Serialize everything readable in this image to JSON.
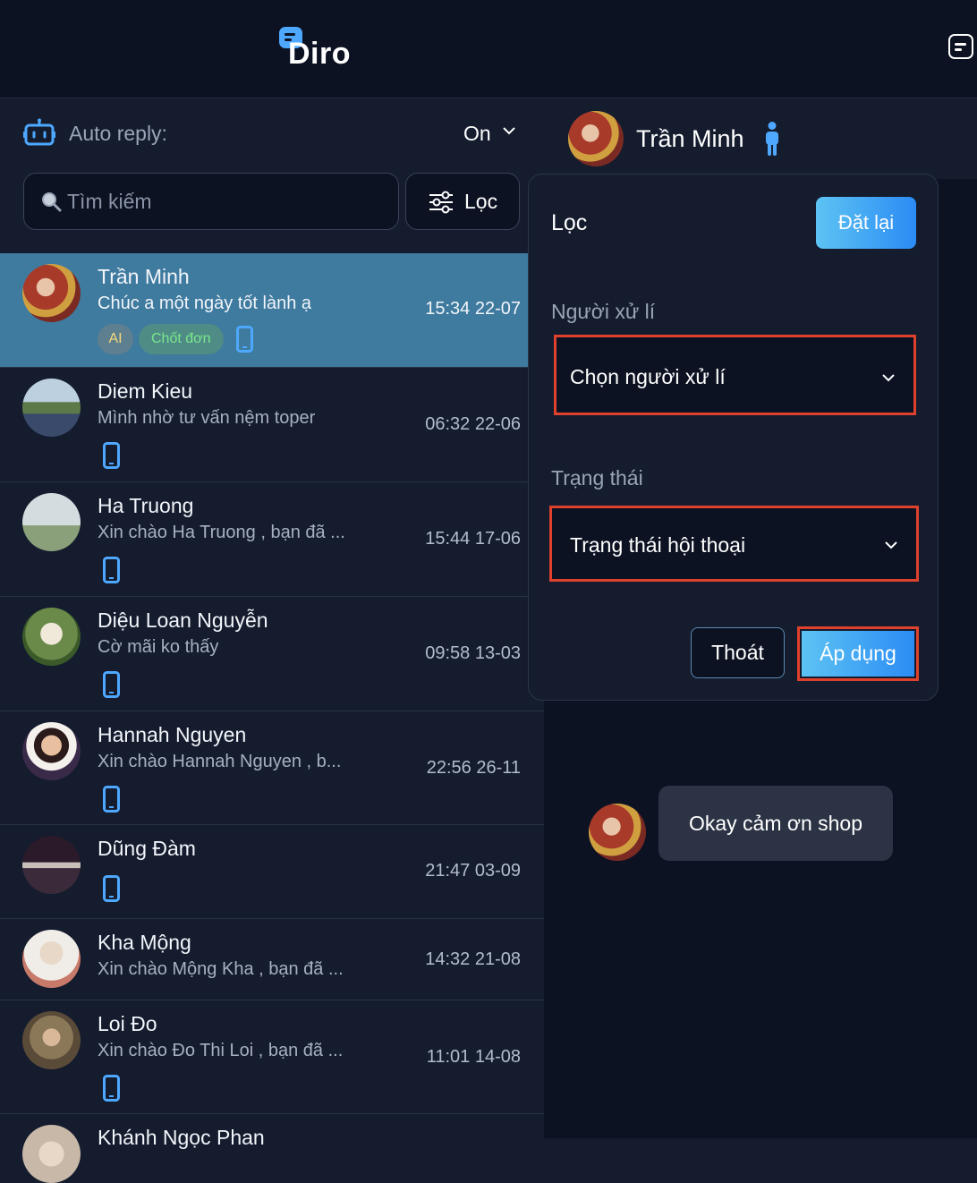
{
  "app": {
    "logo_text": "Diro"
  },
  "autoreply": {
    "label": "Auto reply:",
    "value": "On"
  },
  "search": {
    "placeholder": "Tìm kiếm",
    "value": ""
  },
  "filter_button": {
    "label": "Lọc"
  },
  "conversations": [
    {
      "name": "Trần Minh",
      "message": "Chúc a một ngày tốt lành ạ",
      "time": "15:34 22-07",
      "tags": [
        "AI",
        "Chốt đơn"
      ],
      "avatar_color": "#8a3a2e",
      "active": true
    },
    {
      "name": "Diem Kieu",
      "message": "Mình nhờ tư vấn nệm toper",
      "time": "06:32 22-06",
      "avatar_color": "#6a8fa8"
    },
    {
      "name": "Ha Truong",
      "message": "Xin chào Ha Truong , bạn đã ...",
      "time": "15:44 17-06",
      "avatar_color": "#8ea0a8"
    },
    {
      "name": "Diệu Loan Nguyễn",
      "message": "Cờ mãi ko thấy",
      "time": "09:58 13-03",
      "avatar_color": "#5e7a4a"
    },
    {
      "name": "Hannah Nguyen",
      "message": "Xin chào Hannah Nguyen , b...",
      "time": "22:56 26-11",
      "avatar_color": "#e8e4e0"
    },
    {
      "name": "Dũng Đàm",
      "message": "",
      "time": "21:47 03-09",
      "avatar_color": "#3a2e3a"
    },
    {
      "name": "Kha Mộng",
      "message": "Xin chào Mộng Kha , bạn đã ...",
      "time": "14:32 21-08",
      "avatar_color": "#d8d0c8"
    },
    {
      "name": "Loi Đo",
      "message": "Xin chào Đo Thi Loi , bạn đã ...",
      "time": "11:01 14-08",
      "avatar_color": "#8a7858"
    },
    {
      "name": "Khánh Ngọc Phan",
      "message": "",
      "time": "",
      "avatar_color": "#c8b8a8"
    }
  ],
  "chat": {
    "contact_name": "Trần Minh",
    "messages": [
      {
        "text": "Okay cảm ơn shop"
      }
    ]
  },
  "filter_panel": {
    "title": "Lọc",
    "reset_label": "Đặt lại",
    "handler_label": "Người xử lí",
    "handler_placeholder": "Chọn người xử lí",
    "status_label": "Trạng thái",
    "status_placeholder": "Trạng thái hội thoại",
    "exit_label": "Thoát",
    "apply_label": "Áp dụng"
  },
  "colors": {
    "background": "#141c2e",
    "topbar": "#0c1222",
    "active_row": "#3f7a9f",
    "accent": "#4ea8ff",
    "highlight_border": "#e0412c"
  }
}
